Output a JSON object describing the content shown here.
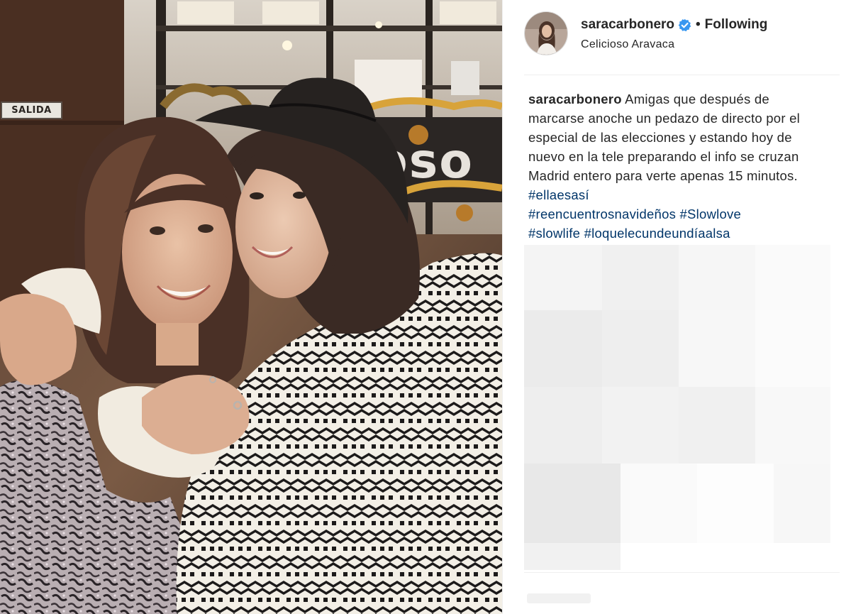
{
  "photo": {
    "sign_text": "SALIDA"
  },
  "header": {
    "username": "saracarbonero",
    "verified_icon": "verified-badge-icon",
    "separator": "•",
    "follow_label": "Following",
    "location": "Celicioso Aravaca"
  },
  "caption": {
    "username": "saracarbonero",
    "text": "Amigas que después de marcarse anoche un pedazo de directo por el especial de las elecciones y estando hoy de nuevo en la tele preparando el info se cruzan Madrid entero para verte apenas 15 minutos.",
    "hashtags": [
      "#ellaesasí",
      "#reencuentrosnavideños",
      "#Slowlove",
      "#slowlife",
      "#loquelecundeundíaalsa"
    ]
  },
  "colors": {
    "accent_blue": "#3897f0",
    "hashtag": "#003569",
    "divider": "#efefef"
  }
}
